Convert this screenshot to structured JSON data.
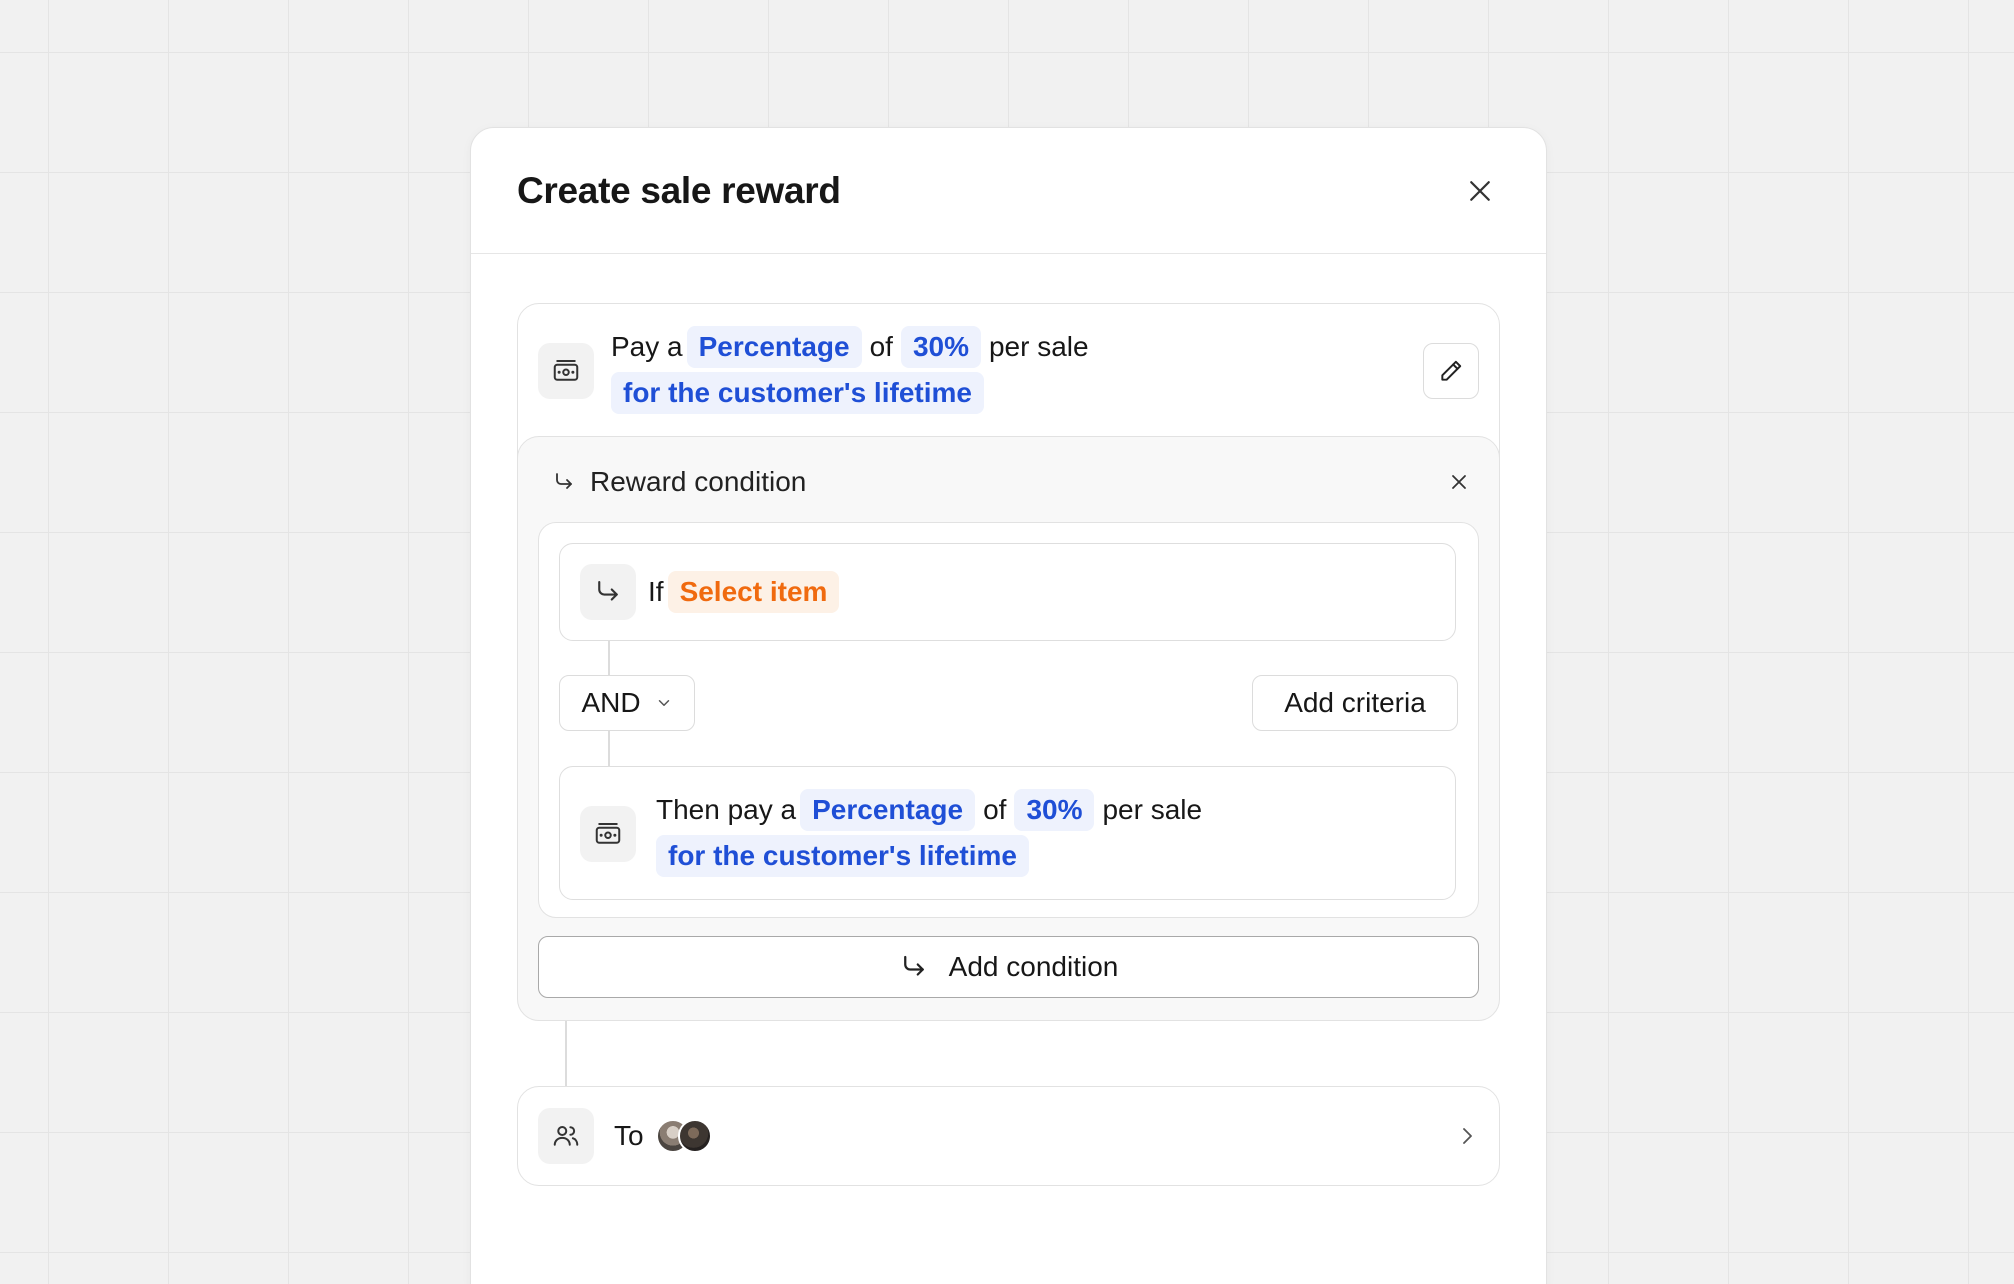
{
  "modal": {
    "title": "Create sale reward"
  },
  "reward": {
    "prefix": "Pay a",
    "type": "Percentage",
    "of": "of",
    "amount": "30%",
    "suffix": "per sale",
    "duration": "for the customer's lifetime"
  },
  "condition": {
    "title": "Reward condition",
    "if_label": "If",
    "select_placeholder": "Select item",
    "operator": "AND",
    "add_criteria_label": "Add criteria",
    "then": {
      "prefix": "Then pay a",
      "type": "Percentage",
      "of": "of",
      "amount": "30%",
      "suffix": "per sale",
      "duration": "for the customer's lifetime"
    },
    "add_condition_label": "Add condition"
  },
  "recipients": {
    "label": "To"
  },
  "colors": {
    "accent_blue": "#1f4fd6",
    "pill_blue_bg": "#eef2fd",
    "accent_orange": "#f06a0f",
    "pill_orange_bg": "#fdf1e6"
  },
  "icons": {
    "close": "close-icon",
    "money": "money-icon",
    "edit": "pencil-icon",
    "branch": "arrow-return-icon",
    "chevron_down": "chevron-down-icon",
    "users": "users-icon",
    "chevron_right": "chevron-right-icon"
  }
}
